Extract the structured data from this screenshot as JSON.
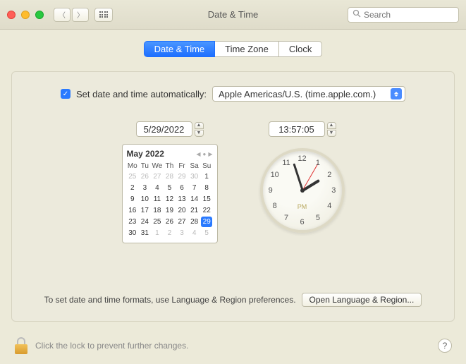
{
  "window": {
    "title": "Date & Time"
  },
  "search": {
    "placeholder": "Search"
  },
  "tabs": {
    "t0": "Date & Time",
    "t1": "Time Zone",
    "t2": "Clock"
  },
  "auto": {
    "label": "Set date and time automatically:",
    "server": "Apple Americas/U.S. (time.apple.com.)"
  },
  "date": {
    "value": "5/29/2022"
  },
  "time": {
    "value": "13:57:05"
  },
  "calendar": {
    "month_label": "May 2022",
    "dow": [
      "Mo",
      "Tu",
      "We",
      "Th",
      "Fr",
      "Sa",
      "Su"
    ],
    "cells": [
      {
        "n": "25",
        "o": true
      },
      {
        "n": "26",
        "o": true
      },
      {
        "n": "27",
        "o": true
      },
      {
        "n": "28",
        "o": true
      },
      {
        "n": "29",
        "o": true
      },
      {
        "n": "30",
        "o": true
      },
      {
        "n": "1"
      },
      {
        "n": "2"
      },
      {
        "n": "3"
      },
      {
        "n": "4"
      },
      {
        "n": "5"
      },
      {
        "n": "6"
      },
      {
        "n": "7"
      },
      {
        "n": "8"
      },
      {
        "n": "9"
      },
      {
        "n": "10"
      },
      {
        "n": "11"
      },
      {
        "n": "12"
      },
      {
        "n": "13"
      },
      {
        "n": "14"
      },
      {
        "n": "15"
      },
      {
        "n": "16"
      },
      {
        "n": "17"
      },
      {
        "n": "18"
      },
      {
        "n": "19"
      },
      {
        "n": "20"
      },
      {
        "n": "21"
      },
      {
        "n": "22"
      },
      {
        "n": "23"
      },
      {
        "n": "24"
      },
      {
        "n": "25"
      },
      {
        "n": "26"
      },
      {
        "n": "27"
      },
      {
        "n": "28"
      },
      {
        "n": "29",
        "s": true
      },
      {
        "n": "30"
      },
      {
        "n": "31"
      },
      {
        "n": "1",
        "o": true
      },
      {
        "n": "2",
        "o": true
      },
      {
        "n": "3",
        "o": true
      },
      {
        "n": "4",
        "o": true
      },
      {
        "n": "5",
        "o": true
      }
    ]
  },
  "clock": {
    "ampm": "PM",
    "hour_angle": 58.5,
    "minute_angle": 342,
    "second_angle": 30
  },
  "footer": {
    "note": "To set date and time formats, use Language & Region preferences.",
    "button": "Open Language & Region..."
  },
  "lock": {
    "label": "Click the lock to prevent further changes.",
    "help": "?"
  }
}
